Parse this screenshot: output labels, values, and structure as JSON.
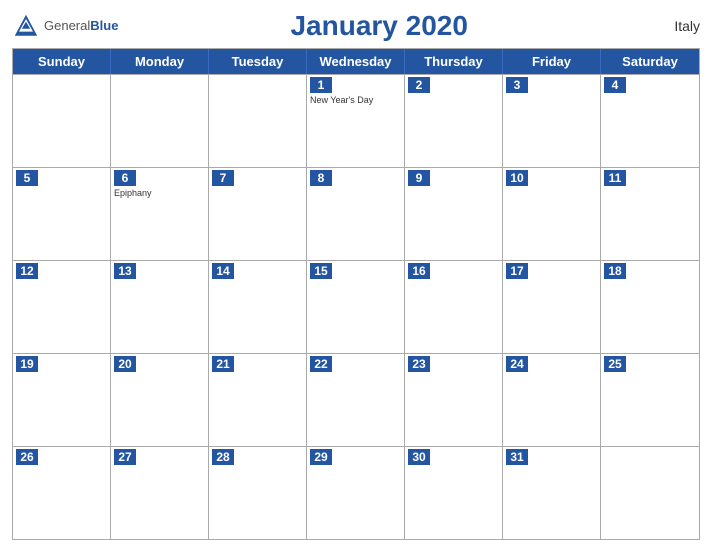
{
  "header": {
    "logo_general": "General",
    "logo_blue": "Blue",
    "title": "January 2020",
    "country": "Italy"
  },
  "calendar": {
    "days": [
      "Sunday",
      "Monday",
      "Tuesday",
      "Wednesday",
      "Thursday",
      "Friday",
      "Saturday"
    ],
    "weeks": [
      [
        {
          "date": "",
          "event": ""
        },
        {
          "date": "",
          "event": ""
        },
        {
          "date": "",
          "event": ""
        },
        {
          "date": "1",
          "event": "New Year's Day"
        },
        {
          "date": "2",
          "event": ""
        },
        {
          "date": "3",
          "event": ""
        },
        {
          "date": "4",
          "event": ""
        }
      ],
      [
        {
          "date": "5",
          "event": ""
        },
        {
          "date": "6",
          "event": "Epiphany"
        },
        {
          "date": "7",
          "event": ""
        },
        {
          "date": "8",
          "event": ""
        },
        {
          "date": "9",
          "event": ""
        },
        {
          "date": "10",
          "event": ""
        },
        {
          "date": "11",
          "event": ""
        }
      ],
      [
        {
          "date": "12",
          "event": ""
        },
        {
          "date": "13",
          "event": ""
        },
        {
          "date": "14",
          "event": ""
        },
        {
          "date": "15",
          "event": ""
        },
        {
          "date": "16",
          "event": ""
        },
        {
          "date": "17",
          "event": ""
        },
        {
          "date": "18",
          "event": ""
        }
      ],
      [
        {
          "date": "19",
          "event": ""
        },
        {
          "date": "20",
          "event": ""
        },
        {
          "date": "21",
          "event": ""
        },
        {
          "date": "22",
          "event": ""
        },
        {
          "date": "23",
          "event": ""
        },
        {
          "date": "24",
          "event": ""
        },
        {
          "date": "25",
          "event": ""
        }
      ],
      [
        {
          "date": "26",
          "event": ""
        },
        {
          "date": "27",
          "event": ""
        },
        {
          "date": "28",
          "event": ""
        },
        {
          "date": "29",
          "event": ""
        },
        {
          "date": "30",
          "event": ""
        },
        {
          "date": "31",
          "event": ""
        },
        {
          "date": "",
          "event": ""
        }
      ]
    ]
  }
}
